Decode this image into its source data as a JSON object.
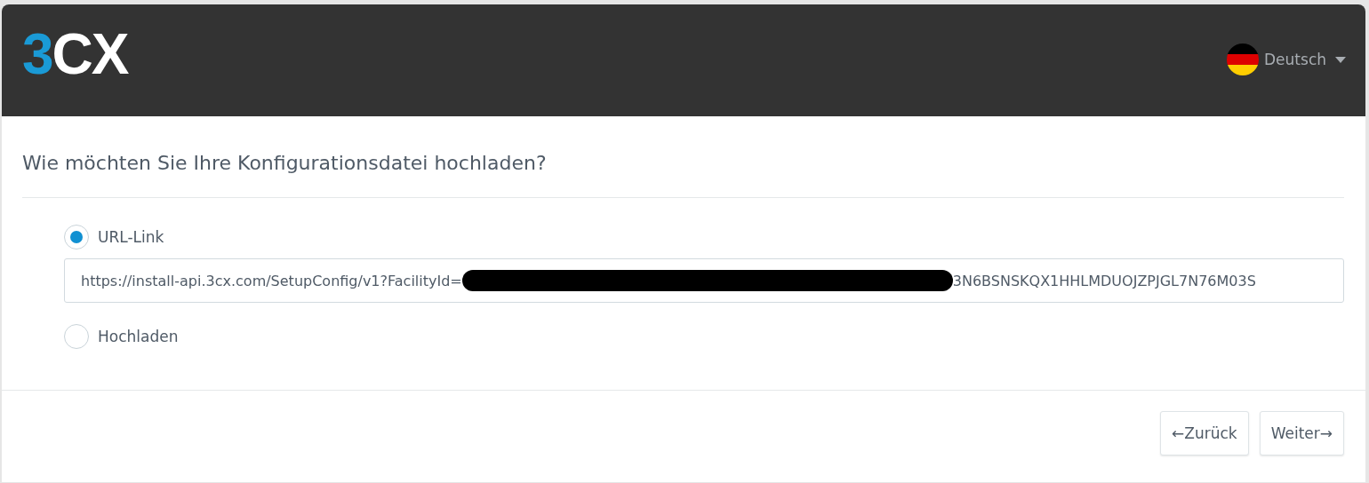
{
  "header": {
    "logo": "3CX",
    "language": "Deutsch"
  },
  "title": "Wie möchten Sie Ihre Konfigurationsdatei hochladen?",
  "options": [
    {
      "label": "URL-Link",
      "selected": true,
      "field": {
        "value_start": "https://install-api.3cx.com/SetupConfig/v1?FacilityId=",
        "redacted": true,
        "value_end": "3N6BSNSKQX1HHLMDUOJZPJGL7N76M03S"
      }
    },
    {
      "label": "Hochladen",
      "selected": false
    }
  ],
  "buttons": [
    "←Zurück",
    "Weiter→"
  ]
}
